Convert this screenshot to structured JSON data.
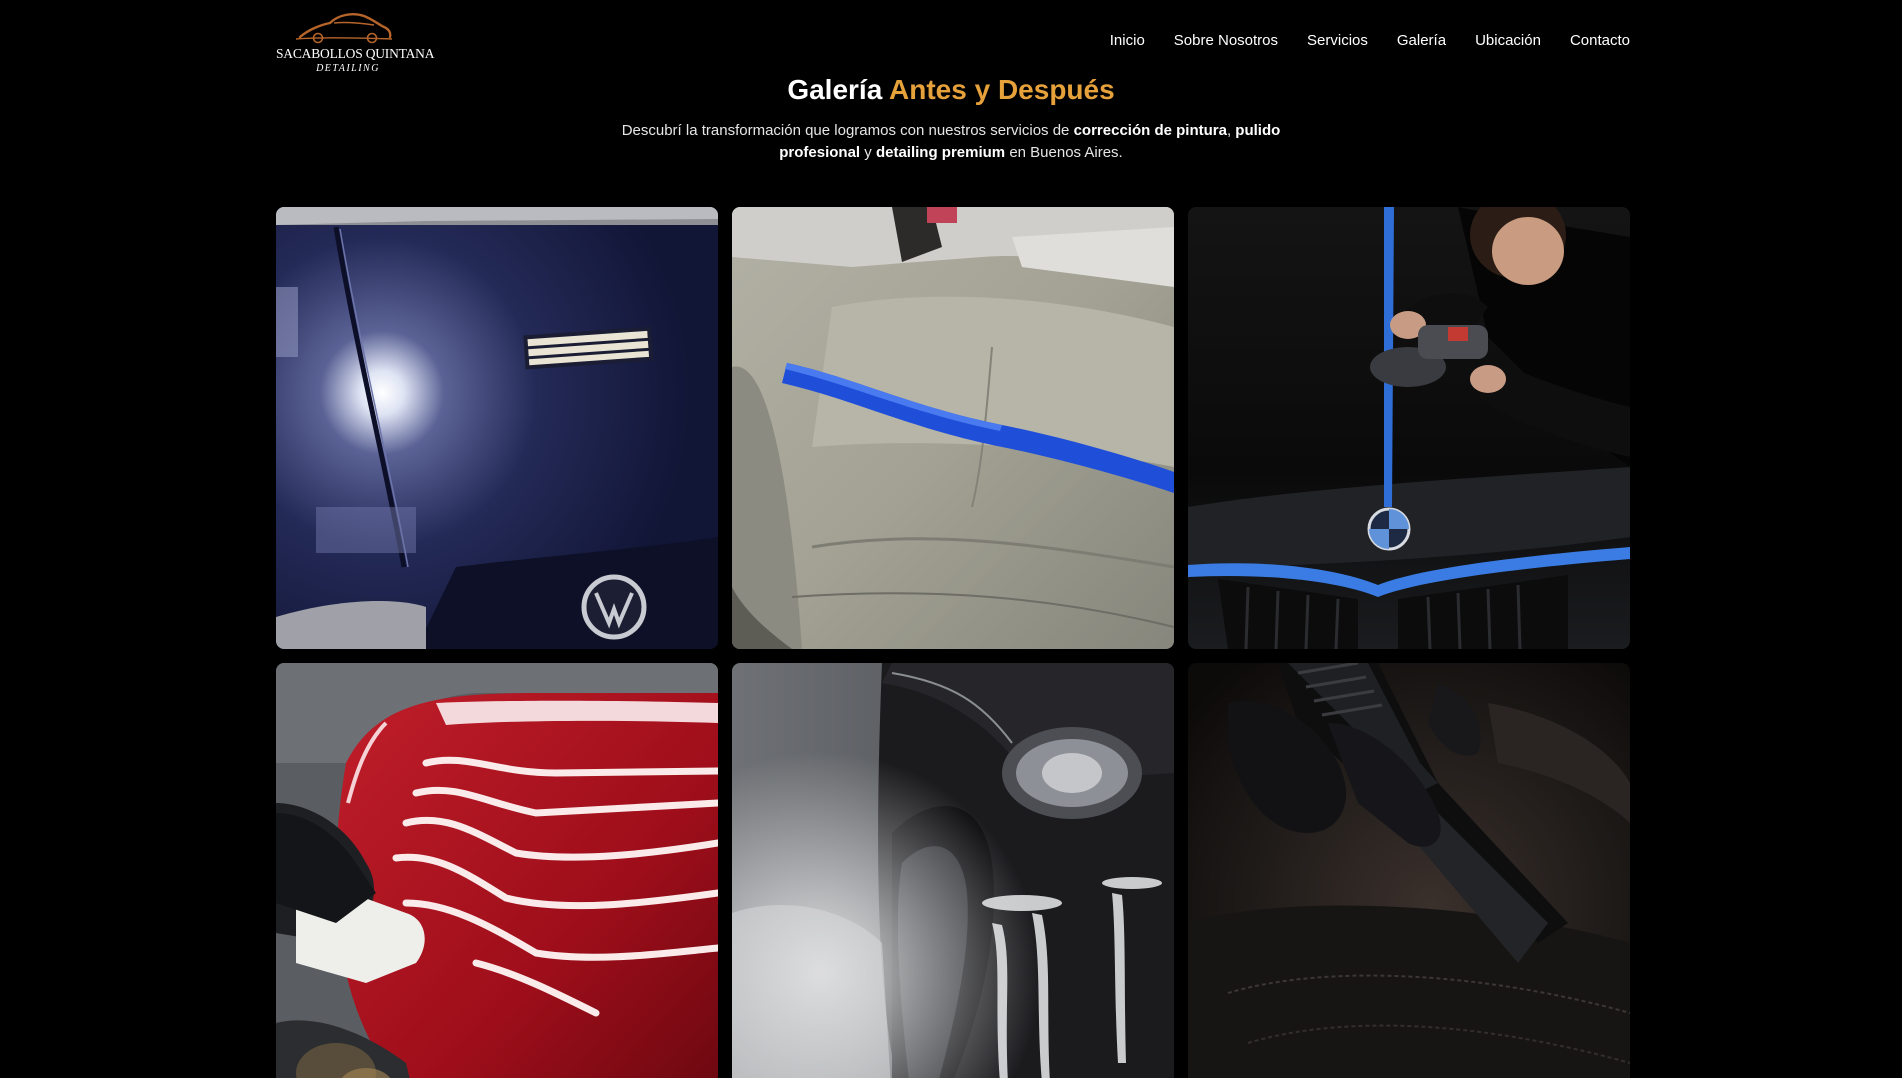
{
  "header": {
    "logo": {
      "brand": "SACABOLLOS QUINTANA",
      "sub": "DETAILING",
      "icon": "car-silhouette-icon",
      "accent_color": "#b5642a"
    },
    "nav": [
      {
        "label": "Inicio"
      },
      {
        "label": "Sobre Nosotros"
      },
      {
        "label": "Servicios"
      },
      {
        "label": "Galería"
      },
      {
        "label": "Ubicación"
      },
      {
        "label": "Contacto"
      }
    ]
  },
  "section": {
    "title_part1": "Galería",
    "title_part2": "Antes y Después",
    "accent_color": "#e6a13b",
    "desc": {
      "t1": "Descubrí la transformación que logramos con nuestros servicios de",
      "b1": "corrección de pintura",
      "t2": ",",
      "b2": "pulido profesional",
      "t3": "y",
      "b3": "detailing premium",
      "t4": "en Buenos Aires."
    }
  },
  "gallery": [
    {
      "subject": "blue-vw-hood-polish"
    },
    {
      "subject": "leather-seat-before-after"
    },
    {
      "subject": "bmw-hood-polishing"
    },
    {
      "subject": "red-car-wax-application"
    },
    {
      "subject": "black-car-foam-wash"
    },
    {
      "subject": "interior-vacuum-cleaning"
    }
  ]
}
